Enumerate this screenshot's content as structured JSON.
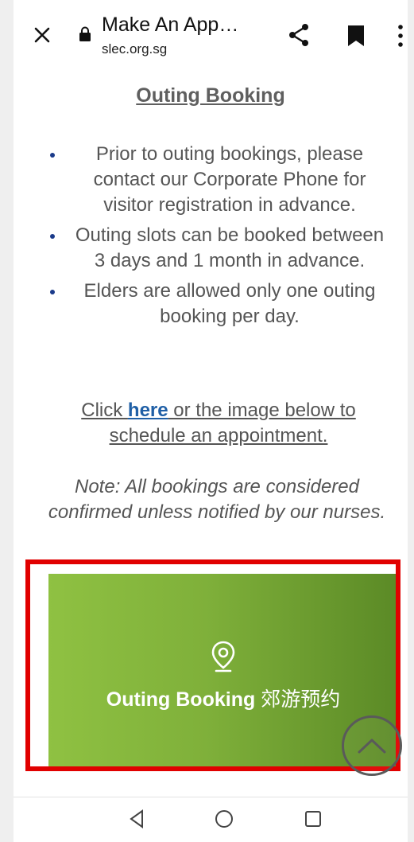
{
  "browser": {
    "title": "Make An App…",
    "url": "slec.org.sg",
    "icons": {
      "close": "close-icon",
      "lock": "lock-icon",
      "share": "share-icon",
      "bookmark": "bookmark-icon",
      "more": "more-vertical-icon"
    }
  },
  "page": {
    "heading": "Outing Booking",
    "bullets": [
      "Prior to outing bookings, please contact our Corporate Phone for visitor registration in advance.",
      "Outing slots can be booked between 3 days and 1 month in advance.",
      "Elders are allowed only one outing booking per day."
    ],
    "click_before": "Click ",
    "click_link": "here",
    "click_after": " or the image below to schedule an appointment.",
    "note": "Note: All bookings are considered confirmed unless notified by our nurses."
  },
  "banner": {
    "label_en": "Outing Booking",
    "label_zh": "郊游预约",
    "icon": "location-pin-icon"
  },
  "scroll_top": {
    "icon": "chevron-up-icon"
  },
  "navbar": {
    "icons": [
      "back-triangle-icon",
      "home-circle-icon",
      "recent-apps-square-icon"
    ]
  },
  "colors": {
    "highlight_border": "#e10000",
    "banner_start": "#8fc142",
    "banner_end": "#5b8a26",
    "link": "#1f5fa6",
    "text": "#555555"
  }
}
